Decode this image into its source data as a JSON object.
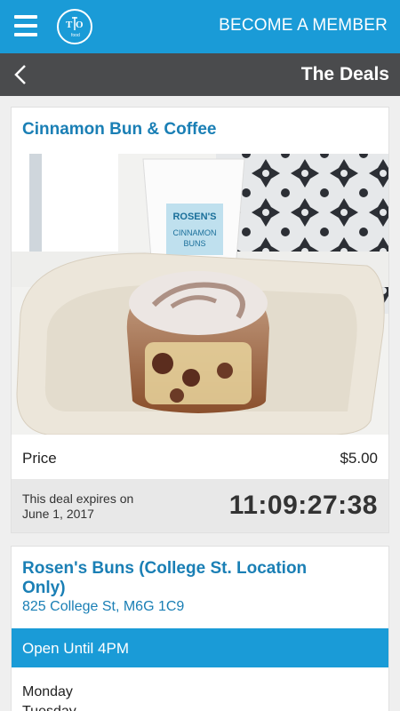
{
  "header": {
    "menu_icon": "hamburger-menu-icon",
    "logo_icon": "to-food-logo-icon",
    "member_label": "BECOME A MEMBER"
  },
  "subheader": {
    "back_icon": "chevron-left-icon",
    "title": "The Deals"
  },
  "deal": {
    "title": "Cinnamon Bun & Coffee",
    "price_label": "Price",
    "price_value": "$5.00",
    "expiry_label": "This deal expires on",
    "expiry_date": "June 1, 2017",
    "countdown": "11:09:27:38",
    "cup_label_line1": "ROSEN'S",
    "cup_label_line2": "CINNAMON",
    "cup_label_line3": "BUNS"
  },
  "location": {
    "name": "Rosen's Buns (College St. Location Only)",
    "address": "825 College St, M6G 1C9",
    "hours_label": "Open Until 4PM",
    "days": [
      "Monday",
      "Tuesday"
    ]
  },
  "colors": {
    "primary": "#1a9bd7",
    "link": "#1a7fb5",
    "dark_bar": "#4a4b4d"
  }
}
